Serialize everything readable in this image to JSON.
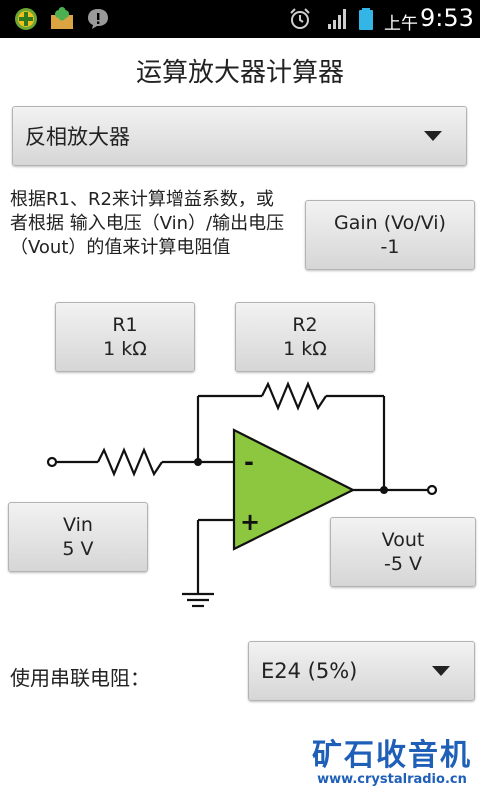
{
  "status_bar": {
    "ampm": "上午",
    "time": "9:53"
  },
  "app": {
    "title": "运算放大器计算器"
  },
  "mode_selector": {
    "selected": "反相放大器"
  },
  "description": "根据R1、R2来计算增益系数，或者根据 输入电压（Vin）/输出电压（Vout）的值来计算电阻值",
  "gain_button": {
    "line1": "Gain (Vo/Vi)",
    "line2": "-1"
  },
  "r1_button": {
    "line1": "R1",
    "line2": "1 kΩ"
  },
  "r2_button": {
    "line1": "R2",
    "line2": "1 kΩ"
  },
  "vin_button": {
    "line1": "Vin",
    "line2": "5 V"
  },
  "vout_button": {
    "line1": "Vout",
    "line2": "-5 V"
  },
  "circuit": {
    "minus_sign": "-",
    "plus_sign": "+",
    "opamp_color": "#8dc63f"
  },
  "series_resistor": {
    "label": "使用串联电阻：",
    "selected": "E24 (5%)"
  },
  "watermark": {
    "name": "矿石收音机",
    "url": "www.crystalradio.cn",
    "color": "#1f5fb8"
  }
}
